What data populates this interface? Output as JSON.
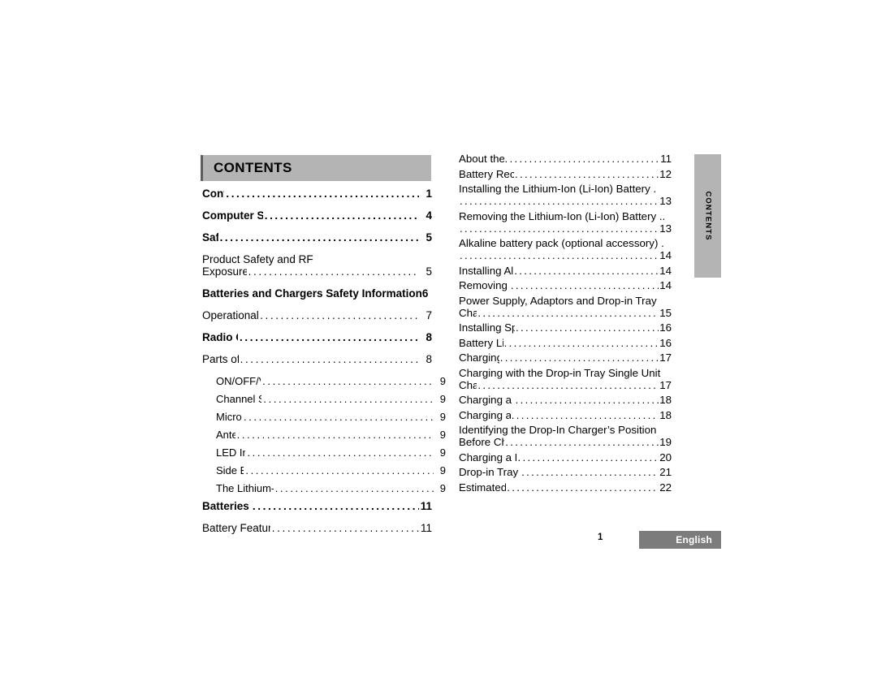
{
  "document": {
    "section_header": "CONTENTS",
    "side_tab_label": "CONTENTS",
    "page_number": "1",
    "language_label": "English"
  },
  "toc": {
    "left_column": [
      {
        "title": "Contents",
        "page": "1",
        "level": "major",
        "leader": true
      },
      {
        "title": "Computer Software Copyrights",
        "page": "4",
        "level": "major",
        "leader": true
      },
      {
        "title": "Safety",
        "page": "5",
        "level": "major",
        "leader": true
      },
      {
        "title_line1": "Product Safety and RF",
        "title_line2": "Exposure Compliance",
        "page": "5",
        "level": "sub",
        "wrapped": true
      },
      {
        "title": "Batteries and Chargers Safety Information",
        "page": "6",
        "level": "major",
        "leader": false
      },
      {
        "title": "Operational Safety Guidelines",
        "page": "7",
        "level": "sub",
        "leader": true
      },
      {
        "title": "Radio Overview",
        "page": "8",
        "level": "major",
        "leader": true
      },
      {
        "title": "Parts of the radio",
        "page": "8",
        "level": "sub",
        "leader": true
      },
      {
        "title": "ON/OFF/Volume Knob",
        "page": "9",
        "level": "sub2",
        "leader": true
      },
      {
        "title": "Channel Selector Knob",
        "page": "9",
        "level": "sub2",
        "leader": true
      },
      {
        "title": "Microphone",
        "page": "9",
        "level": "sub2",
        "leader": true
      },
      {
        "title": "Antenna",
        "page": "9",
        "level": "sub2",
        "leader": true
      },
      {
        "title": "LED Indicator",
        "page": "9",
        "level": "sub2",
        "leader": true
      },
      {
        "title": "Side Buttons",
        "page": "9",
        "level": "sub2",
        "leader": true
      },
      {
        "title": "The Lithium-Ion (Li-Ion) Battery",
        "page": "9",
        "level": "sub2",
        "leader": true
      },
      {
        "title": "Batteries and Chargers",
        "page": "11",
        "level": "major",
        "leader": true
      },
      {
        "title": "Battery Features and Charging Options",
        "page": "11",
        "level": "sub",
        "leader": true
      }
    ],
    "right_column": [
      {
        "title": "About the Li-Ion Battery",
        "page": "11",
        "overflow": false
      },
      {
        "title": "Battery Recycling and Disposal",
        "page": "12",
        "overflow": false
      },
      {
        "title": "Installing the Lithium-Ion (Li-Ion) Battery",
        "page": "13",
        "overflow": true,
        "trail": "."
      },
      {
        "title": "Removing the Lithium-Ion (Li-Ion) Battery",
        "page": "13",
        "overflow": true,
        "trail": ".."
      },
      {
        "title": "Alkaline battery pack (optional accessory)",
        "page": "14",
        "overflow": true,
        "trail": "."
      },
      {
        "title": "Installing Alkaline Battery Pack",
        "page": "14",
        "overflow": false
      },
      {
        "title": "Removing Alkaline Batteries",
        "page": "14",
        "overflow": false
      },
      {
        "title": "Power Supply, Adaptors and Drop-in Tray",
        "title2": "Charger",
        "page": "15",
        "overflow": "two-line"
      },
      {
        "title": "Installing Spring Action Belt Clip",
        "page": "16",
        "overflow": false
      },
      {
        "title": "Battery Life Information",
        "page": "16",
        "overflow": false
      },
      {
        "title": "Charging the Battery",
        "page": "17",
        "overflow": false
      },
      {
        "title": "Charging with the Drop-in Tray Single Unit",
        "title2": "Charger",
        "page": "17",
        "overflow": "two-line"
      },
      {
        "title": "Charging a Stand-alone Battery",
        "page": "18",
        "overflow": false
      },
      {
        "title": "Charging a Standard Battery",
        "page": "18",
        "overflow": false
      },
      {
        "title": "Identifying the Drop-In Charger’s Position",
        "title2": "Before Charging Battery",
        "page": "19",
        "overflow": "two-line"
      },
      {
        "title": "Charging a High Capacity Battery",
        "page": "20",
        "overflow": false
      },
      {
        "title": "Drop-in Tray Charger LED Indicators",
        "page": "21",
        "overflow": false
      },
      {
        "title": "Estimated Charging Time",
        "page": "22",
        "overflow": false
      }
    ]
  },
  "colors": {
    "header_bar": "#b4b4b4",
    "header_bar_edge": "#5c5c5c",
    "side_tab": "#b4b4b4",
    "language_box": "#7c7c7c",
    "text": "#000000"
  }
}
